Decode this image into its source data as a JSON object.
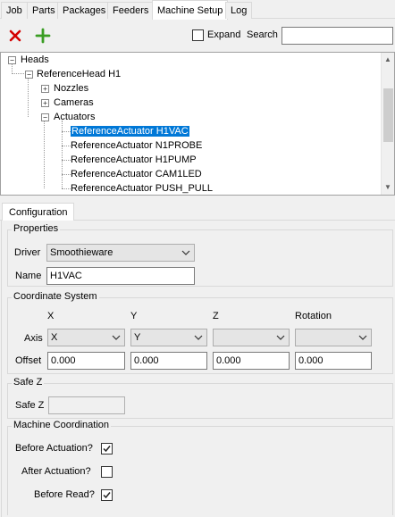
{
  "tabs": [
    "Job",
    "Parts",
    "Packages",
    "Feeders",
    "Machine Setup",
    "Log"
  ],
  "active_tab": "Machine Setup",
  "toolbar": {
    "expand_label": "Expand",
    "search_label": "Search",
    "search_value": ""
  },
  "tree": {
    "root": "Heads",
    "head": "ReferenceHead H1",
    "nozzles": "Nozzles",
    "cameras": "Cameras",
    "actuators": "Actuators",
    "actuator_items": [
      "ReferenceActuator H1VAC",
      "ReferenceActuator N1PROBE",
      "ReferenceActuator H1PUMP",
      "ReferenceActuator CAM1LED",
      "ReferenceActuator PUSH_PULL"
    ],
    "selected": "ReferenceActuator H1VAC"
  },
  "config": {
    "tab_label": "Configuration",
    "properties": {
      "title": "Properties",
      "driver_label": "Driver",
      "driver_value": "Smoothieware",
      "name_label": "Name",
      "name_value": "H1VAC"
    },
    "coordinate_system": {
      "title": "Coordinate System",
      "col_x": "X",
      "col_y": "Y",
      "col_z": "Z",
      "col_rotation": "Rotation",
      "axis_label": "Axis",
      "axis_x": "X",
      "axis_y": "Y",
      "axis_z": "",
      "axis_rotation": "",
      "offset_label": "Offset",
      "offset_x": "0.000",
      "offset_y": "0.000",
      "offset_z": "0.000",
      "offset_rotation": "0.000"
    },
    "safe_z": {
      "title": "Safe Z",
      "label": "Safe Z",
      "value": ""
    },
    "machine_coordination": {
      "title": "Machine Coordination",
      "before_actuation_label": "Before Actuation?",
      "before_actuation": true,
      "after_actuation_label": "After Actuation?",
      "after_actuation": false,
      "before_read_label": "Before Read?",
      "before_read": true
    }
  },
  "colors": {
    "selection": "#0078d7",
    "delete_icon": "#d40000",
    "add_icon": "#3a9d23"
  }
}
